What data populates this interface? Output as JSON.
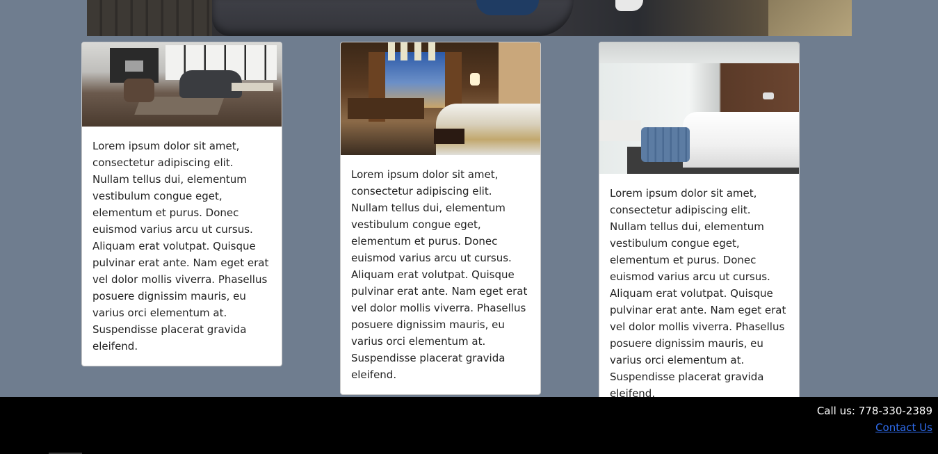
{
  "cards": [
    {
      "image_alt": "living-room",
      "text": "Lorem ipsum dolor sit amet, consectetur adipiscing elit. Nullam tellus dui, elementum vestibulum congue eget, elementum et purus. Donec euismod varius arcu ut cursus. Aliquam erat volutpat. Quisque pulvinar erat ante. Nam eget erat vel dolor mollis viverra. Phasellus posuere dignissim mauris, eu varius orci elementum at. Suspendisse placerat gravida eleifend."
    },
    {
      "image_alt": "hotel-room-city-view",
      "text": "Lorem ipsum dolor sit amet, consectetur adipiscing elit. Nullam tellus dui, elementum vestibulum congue eget, elementum et purus. Donec euismod varius arcu ut cursus. Aliquam erat volutpat. Quisque pulvinar erat ante. Nam eget erat vel dolor mollis viverra. Phasellus posuere dignissim mauris, eu varius orci elementum at. Suspendisse placerat gravida eleifend."
    },
    {
      "image_alt": "bright-hotel-room",
      "text": "Lorem ipsum dolor sit amet, consectetur adipiscing elit. Nullam tellus dui, elementum vestibulum congue eget, elementum et purus. Donec euismod varius arcu ut cursus. Aliquam erat volutpat. Quisque pulvinar erat ante. Nam eget erat vel dolor mollis viverra. Phasellus posuere dignissim mauris, eu varius orci elementum at. Suspendisse placerat gravida eleifend."
    }
  ],
  "footer": {
    "call": "Call us: 778-330-2389",
    "contact_label": "Contact Us"
  },
  "colors": {
    "page_background": "#6f7d8f",
    "footer_background": "#000000",
    "link": "#2f6df0"
  }
}
